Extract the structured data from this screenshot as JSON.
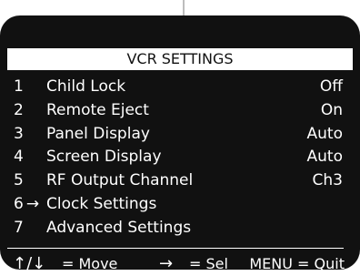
{
  "title": "VCR SETTINGS",
  "items": [
    {
      "number": "1",
      "label": "Child Lock",
      "value": "Off"
    },
    {
      "number": "2",
      "label": "Remote Eject",
      "value": "On"
    },
    {
      "number": "3",
      "label": "Panel Display",
      "value": "Auto"
    },
    {
      "number": "4",
      "label": "Screen Display",
      "value": "Auto"
    },
    {
      "number": "5",
      "label": "RF Output Channel",
      "value": "Ch3"
    },
    {
      "number": "6",
      "label": "Clock Settings",
      "value": "",
      "selected": true
    },
    {
      "number": "7",
      "label": "Advanced Settings",
      "value": ""
    }
  ],
  "cursor_glyph": "→",
  "footer": {
    "move_keys": "↑/↓",
    "move_text": "= Move",
    "sel_key": "→",
    "sel_text": "= Sel",
    "quit_text": "MENU = Quit"
  },
  "colors": {
    "screen": "#111111",
    "text": "#ffffff",
    "title_bar": "#ffffff",
    "title_text": "#111111"
  }
}
